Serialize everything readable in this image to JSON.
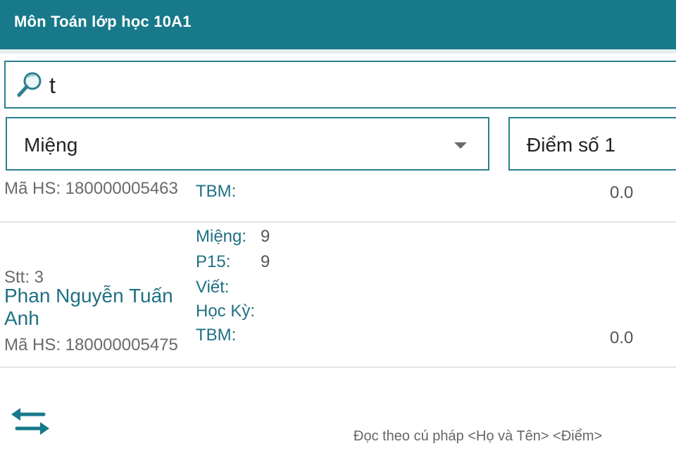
{
  "header": {
    "title": "Môn Toán lớp học 10A1"
  },
  "search": {
    "value": "t",
    "icon": "search-icon"
  },
  "filters": {
    "left": {
      "selected": "Miệng"
    },
    "right": {
      "selected": "Điểm số 1"
    }
  },
  "students": [
    {
      "id_text": "Mã HS: 180000005463",
      "scores": {
        "tbm_label": "TBM:",
        "tbm_value": "0.0"
      }
    },
    {
      "stt": "Stt: 3",
      "name": "Phan Nguyễn Tuấn Anh",
      "id_text": "Mã HS: 180000005475",
      "scores": {
        "mieng_label": "Miệng:",
        "mieng_value": "9",
        "p15_label": "P15:",
        "p15_value": "9",
        "viet_label": "Viết:",
        "hocky_label": "Học Kỳ:",
        "tbm_label": "TBM:",
        "tbm_value": "0.0"
      }
    }
  ],
  "footer": {
    "note": "Đọc theo cú pháp <Họ và Tên> <Điểm>",
    "swap_icon": "swap-arrows-icon"
  },
  "colors": {
    "primary": "#17798a",
    "accent_text": "#1f7083"
  }
}
